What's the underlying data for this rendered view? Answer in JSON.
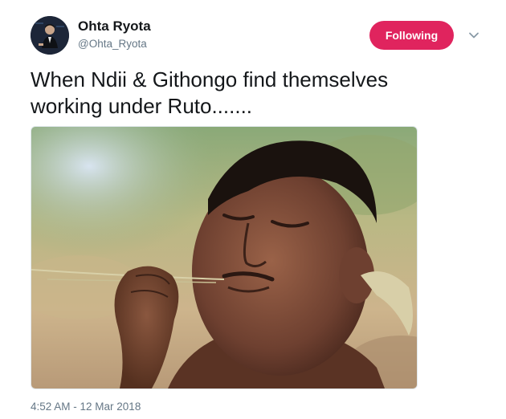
{
  "user": {
    "display_name": "Ohta Ryota",
    "screen_name": "@Ohta_Ryota",
    "avatar_icon": "profile-photo"
  },
  "follow_button": {
    "label": "Following",
    "color": "#e0245e"
  },
  "menu_icon": "chevron-down-icon",
  "tweet": {
    "text": "When Ndii & Githongo find themselves\nworking under Ruto.......",
    "media": "photo"
  },
  "timestamp": "4:52 AM - 12 Mar 2018",
  "colors": {
    "text": "#14171a",
    "secondary": "#657786",
    "border": "#e1e8ed"
  }
}
